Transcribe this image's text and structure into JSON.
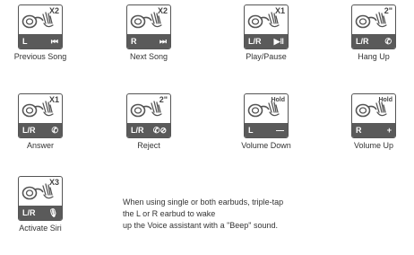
{
  "items": [
    {
      "action": "X2",
      "side": "L",
      "control": "⏮",
      "caption": "Previous Song"
    },
    {
      "action": "X2",
      "side": "R",
      "control": "⏭",
      "caption": "Next Song"
    },
    {
      "action": "X1",
      "side": "L/R",
      "control": "▶‖",
      "caption": "Play/Pause"
    },
    {
      "action": "2\"",
      "side": "L/R",
      "control": "✆",
      "caption": "Hang Up"
    },
    {
      "action": "X1",
      "side": "L/R",
      "control": "✆",
      "caption": "Answer"
    },
    {
      "action": "2\"",
      "side": "L/R",
      "control": "✆⊘",
      "caption": "Reject"
    },
    {
      "action": "Hold",
      "side": "L",
      "control": "—",
      "caption": "Volume Down"
    },
    {
      "action": "Hold",
      "side": "R",
      "control": "+",
      "caption": "Volume Up"
    },
    {
      "action": "X3",
      "side": "L/R",
      "control": "🎙",
      "caption": "Activate Siri"
    }
  ],
  "note": {
    "line1": "When using single or both earbuds, triple-tap",
    "line2": "the L or R earbud to wake",
    "line3": "up the Voice assistant with a \"Beep\" sound."
  }
}
